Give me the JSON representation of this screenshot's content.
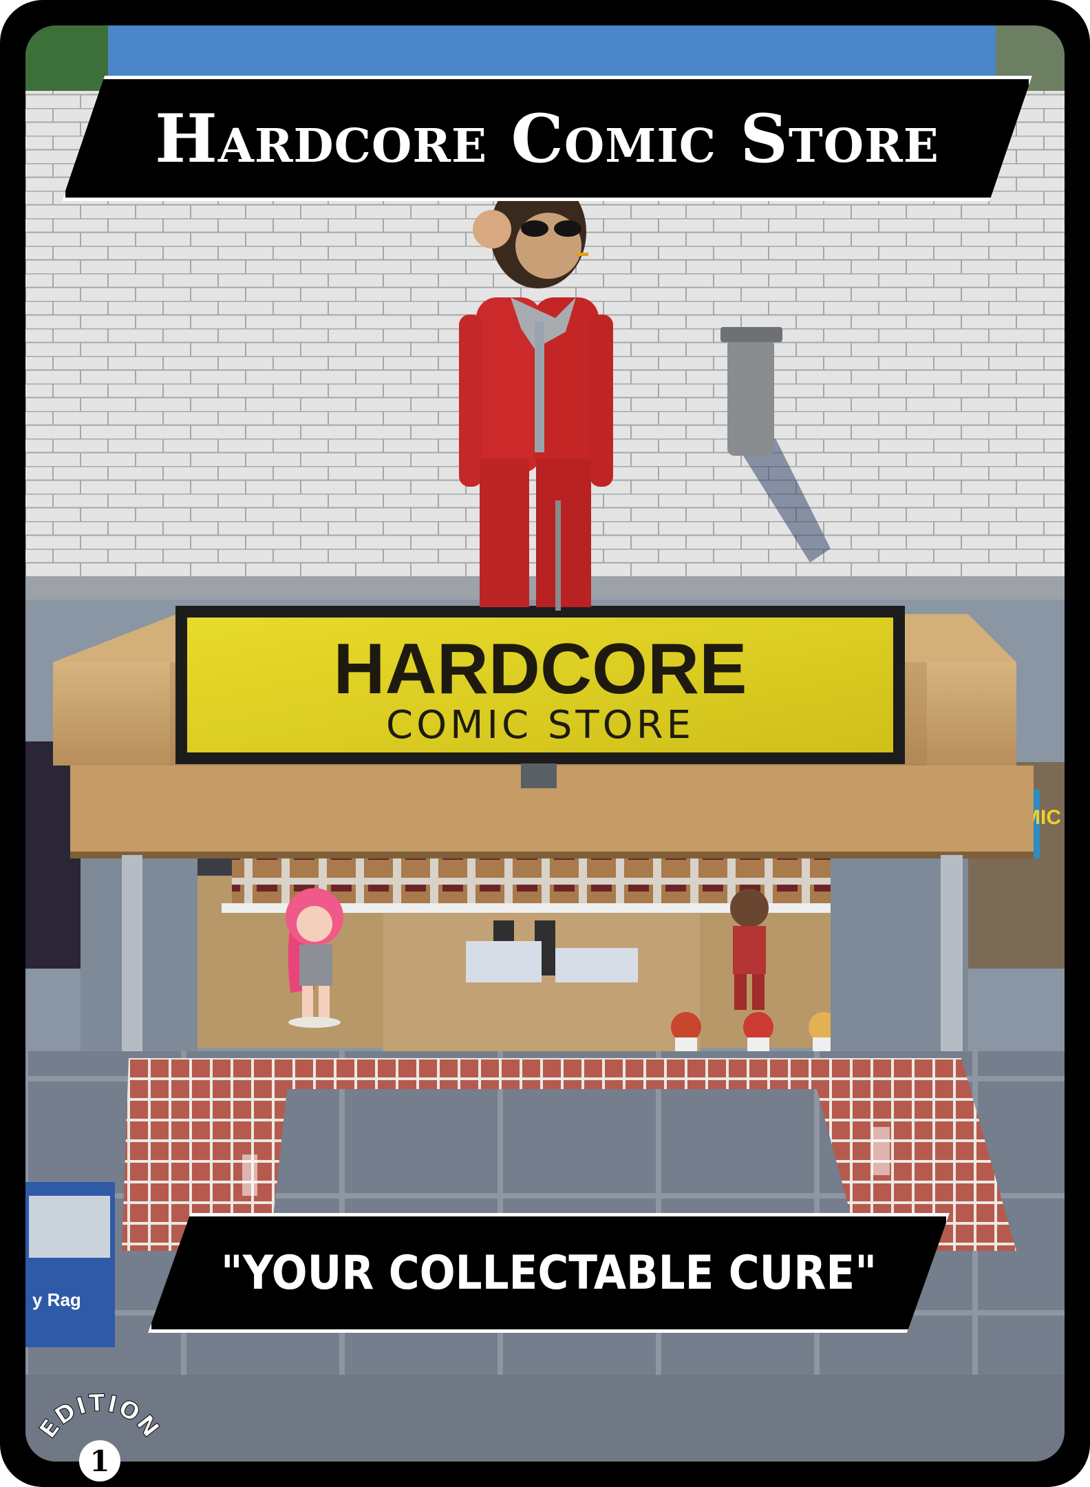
{
  "card": {
    "title": "Hardcore Comic Store",
    "tagline": "\"YOUR COLLECTABLE CURE\"",
    "edition_label": "EDITION",
    "edition_number": "1"
  },
  "scene": {
    "sign_line1": "HARDCORE",
    "sign_line2": "COMIC STORE",
    "side_sign": "COMIC",
    "newsbox_text": "y Rag"
  },
  "colors": {
    "card_border": "#000000",
    "banner_bg": "#000000",
    "banner_text": "#ffffff",
    "sign_yellow": "#e2d419",
    "suit_red": "#cc2222",
    "sky": "#4a86c8"
  },
  "icons": [
    "edition-badge-icon"
  ]
}
